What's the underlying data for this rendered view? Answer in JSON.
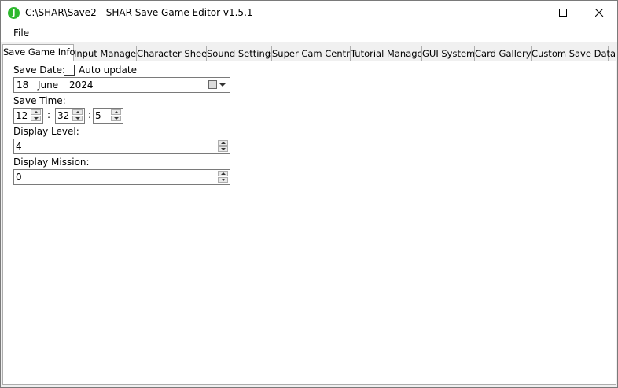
{
  "window": {
    "title": "C:\\SHAR\\Save2 - SHAR Save Game Editor v1.5.1",
    "icon_letter": "J"
  },
  "menu": {
    "file": "File"
  },
  "tabs": [
    {
      "label": "Save Game Info",
      "active": true
    },
    {
      "label": "Input Manager"
    },
    {
      "label": "Character Sheet"
    },
    {
      "label": "Sound Settings"
    },
    {
      "label": "Super Cam Central"
    },
    {
      "label": "Tutorial Manager"
    },
    {
      "label": "GUI System"
    },
    {
      "label": "Card Gallery"
    },
    {
      "label": "Custom Save Data"
    }
  ],
  "save_date": {
    "label": "Save Date:",
    "auto_update_label": "Auto update",
    "auto_update_checked": false,
    "day": "18",
    "month": "June",
    "year": "2024"
  },
  "save_time": {
    "label": "Save Time:",
    "hour": "12",
    "minute": "32",
    "second": "5",
    "separator": ":"
  },
  "display_level": {
    "label": "Display Level:",
    "value": "4"
  },
  "display_mission": {
    "label": "Display Mission:",
    "value": "0"
  }
}
